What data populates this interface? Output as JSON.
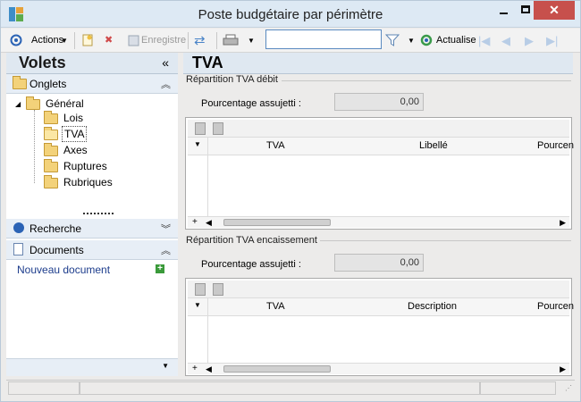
{
  "window": {
    "title": "Poste budgétaire par périmètre"
  },
  "toolbar": {
    "actions_label": "Actions",
    "enregistrer_label": "Enregistre",
    "actualise_label": "Actualise",
    "search_value": ""
  },
  "left_pane": {
    "title": "Volets",
    "onglets_label": "Onglets",
    "tree": {
      "root": "Général",
      "children": [
        "Lois",
        "TVA",
        "Axes",
        "Ruptures",
        "Rubriques"
      ]
    },
    "recherche_label": "Recherche",
    "documents_label": "Documents",
    "nouveau_document": "Nouveau document"
  },
  "main": {
    "title": "TVA",
    "debit": {
      "group_title": "Répartition TVA débit",
      "pourcentage_label": "Pourcentage assujetti :",
      "pourcentage_value": "0,00",
      "columns": [
        "TVA",
        "Libellé",
        "Pourcen"
      ]
    },
    "encaissement": {
      "group_title": "Répartition TVA encaissement",
      "pourcentage_label": "Pourcentage assujetti :",
      "pourcentage_value": "0,00",
      "columns": [
        "TVA",
        "Description",
        "Pourcen"
      ]
    }
  },
  "colors": {
    "titlebar": "#dde9f4",
    "close_button": "#c7504c",
    "pane_header": "#dfe8f1",
    "link_blue": "#1c3c8c"
  }
}
